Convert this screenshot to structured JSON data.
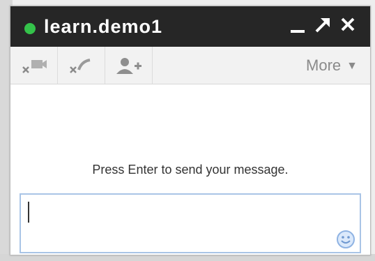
{
  "window": {
    "title": "learn.demo1",
    "status_color": "#34c24a",
    "titlebar_color": "#262626",
    "controls": {
      "minimize_icon": "minimize-icon",
      "popout_icon": "popout-arrow-icon",
      "close_icon": "close-icon"
    }
  },
  "toolbar": {
    "items": [
      {
        "name": "video-call-icon",
        "disabled": true
      },
      {
        "name": "voice-call-icon",
        "disabled": true
      },
      {
        "name": "add-person-icon",
        "disabled": false
      }
    ],
    "more_label": "More",
    "more_arrow": "▼"
  },
  "compose": {
    "hint": "Press Enter to send your message.",
    "value": "",
    "emoji_icon": "smiley-icon",
    "border_color": "#a9c4e6"
  }
}
